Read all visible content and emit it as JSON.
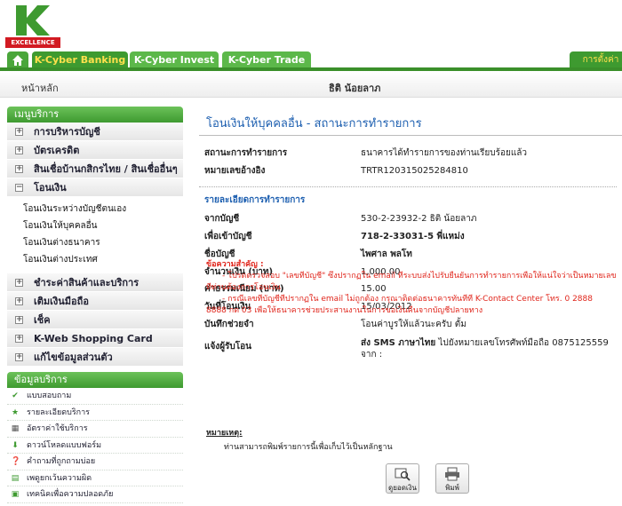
{
  "brand": {
    "logo_letter": "K",
    "logo_tagline": "EXCELLENCE",
    "accent": "#3e9a30",
    "red": "#d21a22"
  },
  "nav": {
    "tabs": [
      {
        "label": "K-Cyber Banking"
      },
      {
        "label": "K-Cyber Invest"
      },
      {
        "label": "K-Cyber Trade"
      },
      {
        "label": "การตั้งค่า"
      }
    ]
  },
  "subbar": {
    "home": "หน้าหลัก",
    "user": "ธิติ น้อยลาภ"
  },
  "sidebar": {
    "menu_title": "เมนูบริการ",
    "items": [
      {
        "label": "การบริหารบัญชี",
        "toggle": "+"
      },
      {
        "label": "บัตรเครดิต",
        "toggle": "+"
      },
      {
        "label": "สินเชื่อบ้านกสิกรไทย / สินเชื่ออื่นๆ",
        "toggle": "+"
      },
      {
        "label": "โอนเงิน",
        "toggle": "−"
      }
    ],
    "transfer_sub": [
      {
        "label": "โอนเงินระหว่างบัญชีตนเอง"
      },
      {
        "label": "โอนเงินให้บุคคลอื่น"
      },
      {
        "label": "โอนเงินต่างธนาคาร"
      },
      {
        "label": "โอนเงินต่างประเทศ"
      }
    ],
    "items2": [
      {
        "label": "ชำระค่าสินค้าและบริการ",
        "toggle": "+"
      },
      {
        "label": "เติมเงินมือถือ",
        "toggle": "+"
      },
      {
        "label": "เช็ค",
        "toggle": "+"
      },
      {
        "label": "K-Web Shopping Card",
        "toggle": "+"
      },
      {
        "label": "แก้ไขข้อมูลส่วนตัว",
        "toggle": "+"
      }
    ],
    "service_title": "ข้อมูลบริการ",
    "services": [
      {
        "label": "แบบสอบถาม",
        "icon": "checkmark-icon"
      },
      {
        "label": "รายละเอียดบริการ",
        "icon": "star-icon"
      },
      {
        "label": "อัตราค่าใช้บริการ",
        "icon": "calculator-icon"
      },
      {
        "label": "ดาวน์โหลดแบบฟอร์ม",
        "icon": "download-icon"
      },
      {
        "label": "คำถามที่ถูกถามบ่อย",
        "icon": "question-icon"
      },
      {
        "label": "เพดูยกเว้นความผิด",
        "icon": "document-icon"
      },
      {
        "label": "เทคนิคเพื่อความปลอดภัย",
        "icon": "lock-icon"
      }
    ]
  },
  "main": {
    "title": "โอนเงินให้บุคคลอื่น - สถานะการทำรายการ",
    "status_label": "สถานะการทำรายการ",
    "status_value": "ธนาคารได้ทำรายการของท่านเรียบร้อยแล้ว",
    "ref_label": "หมายเลขอ้างอิง",
    "ref_value": "TRTR120315025284810",
    "details_title": "รายละเอียดการทำรายการ",
    "details": [
      {
        "label": "จากบัญชี",
        "value": "530-2-23932-2 ธิติ น้อยลาภ",
        "bold": false
      },
      {
        "label": "เพื่อเข้าบัญชี",
        "value": "718-2-33031-5 พี่แหม่ง",
        "bold": true
      },
      {
        "label": "ชื่อบัญชี",
        "value": "ไพศาล พลโท",
        "bold": true
      },
      {
        "label": "จำนวนเงิน (บาท)",
        "value": "1,000.00",
        "bold": false
      },
      {
        "label": "ค่าธรรมเนียม (บาท)",
        "value": "15.00",
        "bold": false
      },
      {
        "label": "วันที่โอนเงิน",
        "value": "15/03/2012",
        "bold": false
      },
      {
        "label": "บันทึกช่วยจำ",
        "value": "โอนค่าบูรให้แล้วนะครับ ตั้ม",
        "bold": false
      }
    ],
    "notify_label": "แจ้งผู้รับโอน",
    "notify_value_line1_prefix": "ส่ง SMS ภาษาไทย",
    "notify_value_line1_rest": " ไปยังหมายเลขโทรศัพท์มือถือ 0875125559",
    "notify_value_line2": "จาก :",
    "notice_title": "ข้อความสำคัญ :",
    "notice_1a": "- โปรดตรวจสอบ \"เลขที่บัญชี\" ซึ่งปรากฏใน email ที่ระบบส่งไปรับยืนยันการทำรายการเพื่อให้แน่ใจว่าเป็นหมายเลข",
    "notice_1b": "ที่ท่านต้องการโอนเงิน",
    "notice_2a": "- กรณีเลขที่บัญชีที่ปรากฏใน email ไม่ถูกต้อง กรุณาติดต่อธนาคารทันทีที่ K-Contact Center โทร. 0 2888",
    "notice_2b": "8888 กด 03 เพื่อให้ธนาคารช่วยประสานงานในการขอเงินคืนจากบัญชีปลายทาง",
    "note_title": "หมายเหตุ:",
    "note_body": "ท่านสามารถพิมพ์รายการนี้เพื่อเก็บไว้เป็นหลักฐาน",
    "btn_view": "ดูยอดเงิน",
    "btn_print": "พิมพ์"
  }
}
